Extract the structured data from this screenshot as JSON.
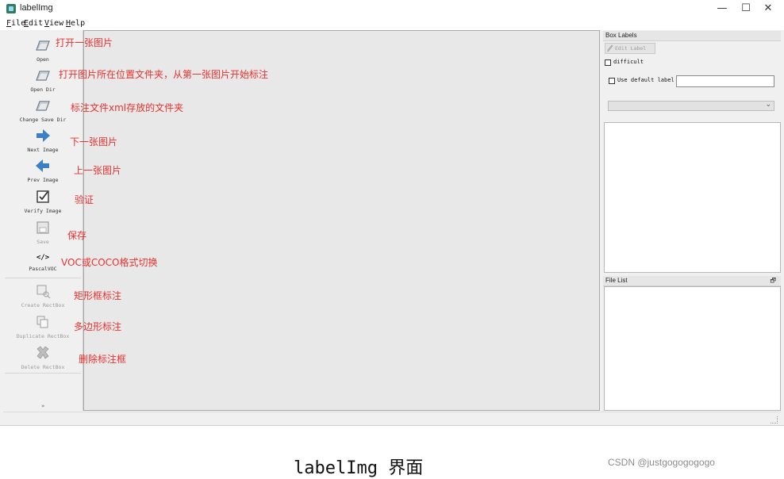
{
  "window": {
    "title": "labelImg",
    "controls": {
      "minimize": "—",
      "maximize": "☐",
      "close": "✕"
    }
  },
  "menu": [
    {
      "u": "F",
      "rest": "ile"
    },
    {
      "u": "E",
      "rest": "dit"
    },
    {
      "u": "V",
      "rest": "iew"
    },
    {
      "u": "H",
      "rest": "elp"
    }
  ],
  "toolbar": {
    "open": "Open",
    "open_dir": "Open Dir",
    "change_save_dir": "Change Save Dir",
    "next_image": "Next Image",
    "prev_image": "Prev Image",
    "verify_image": "Verify Image",
    "save": "Save",
    "format": "PascalVOC",
    "format_icon_text": "</>",
    "create_rectbox": "Create RectBox",
    "duplicate_rectbox": "Duplicate RectBox",
    "delete_rectbox": "Delete RectBox",
    "extension": "»"
  },
  "box_labels": {
    "title": "Box Labels",
    "edit_label": "Edit Label",
    "difficult": "difficult",
    "use_default_label": "Use default label",
    "default_label_value": "",
    "combo_value": ""
  },
  "file_list": {
    "title": "File List",
    "float_icon": "🗗"
  },
  "annotations": {
    "open": "打开一张图片",
    "open_dir": "打开图片所在位置文件夹，从第一张图片开始标注",
    "change_save_dir": "标注文件xml存放的文件夹",
    "next_image": "下一张图片",
    "prev_image": "上一张图片",
    "verify": "验证",
    "save": "保存",
    "format": "VOC或COCO格式切换",
    "create_rectbox": "矩形框标注",
    "duplicate_rectbox": "多边形标注",
    "delete_rectbox": "删除标注框"
  },
  "caption": "labelImg 界面",
  "watermark": "CSDN @justgogogogogo",
  "colors": {
    "annotation": "#e8322f",
    "arrow": "#3d7fc4"
  }
}
